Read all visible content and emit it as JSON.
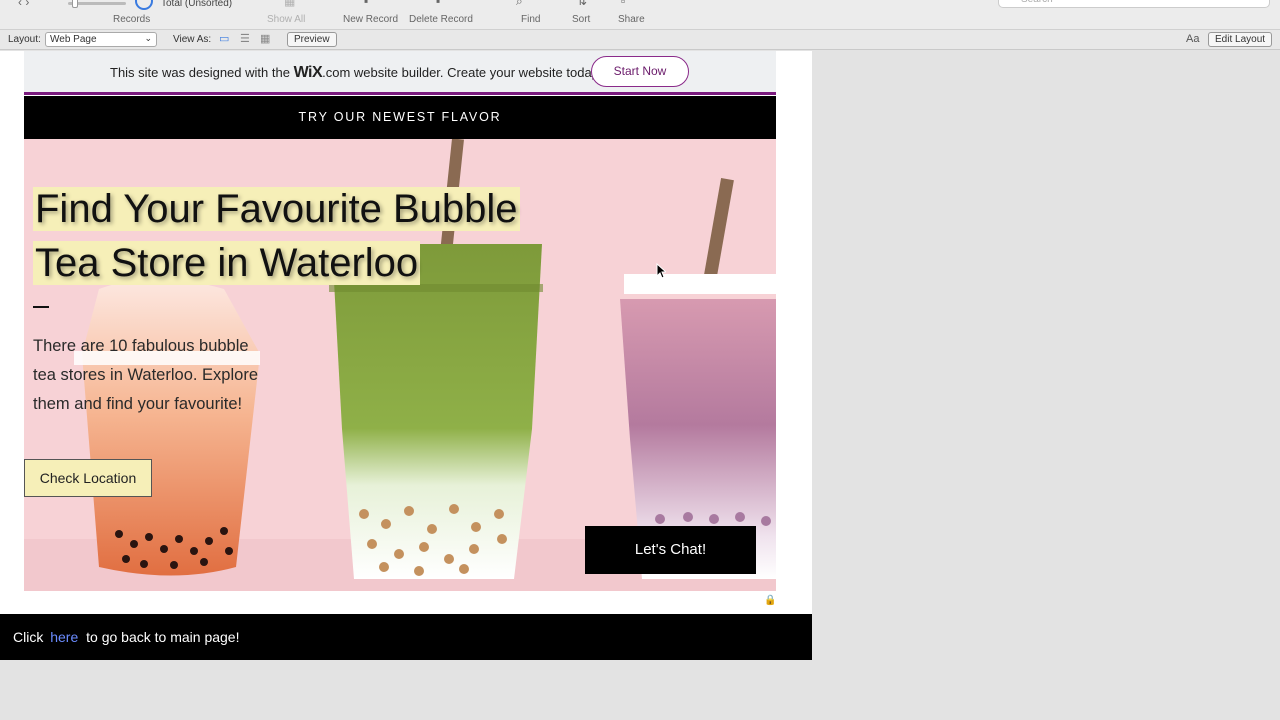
{
  "toolbar": {
    "records_label": "Records",
    "total_label": "Total (Unsorted)",
    "show_all_label": "Show All",
    "new_record_label": "New Record",
    "delete_record_label": "Delete Record",
    "find_label": "Find",
    "sort_label": "Sort",
    "share_label": "Share",
    "search_placeholder": "Search"
  },
  "layout_bar": {
    "layout_label": "Layout:",
    "layout_value": "Web Page",
    "view_as_label": "View As:",
    "preview_label": "Preview",
    "edit_layout_label": "Edit Layout",
    "font_icon_text": "Aa"
  },
  "wix_banner": {
    "text_before": "This site was designed with the",
    "logo": "WiX",
    "text_after": ".com website builder. Create your website today.",
    "button": "Start Now"
  },
  "flavor_bar": {
    "text": "TRY OUR NEWEST FLAVOR"
  },
  "hero": {
    "headline_line1": "Find Your Favourite Bubble",
    "headline_line2": "Tea Store in Waterloo",
    "body": "There are 10 fabulous bubble tea stores in Waterloo. Explore them and find your favourite!",
    "check_button": "Check Location",
    "chat_button": "Let's Chat!"
  },
  "footer": {
    "prefix": "Click",
    "link": "here",
    "suffix": "to go back to main page!"
  },
  "colors": {
    "hero_bg": "#f7d2d6",
    "highlight": "#f6efb8",
    "wix_purple": "#7a1a7e",
    "link_blue": "#6b8cff"
  }
}
